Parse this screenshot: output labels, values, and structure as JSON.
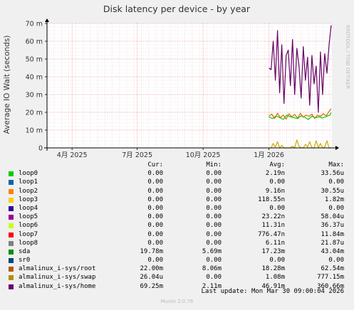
{
  "chart_data": {
    "type": "line",
    "title": "Disk latency per device - by year",
    "ylabel": "Average IO Wait (seconds)",
    "side_label": "RRDTOOL / TOBI OETIKER",
    "ylim": [
      0,
      0.07
    ],
    "y_ticks": [
      {
        "value": 0,
        "label": "0"
      },
      {
        "value": 0.01,
        "label": "10 m"
      },
      {
        "value": 0.02,
        "label": "20 m"
      },
      {
        "value": 0.03,
        "label": "30 m"
      },
      {
        "value": 0.04,
        "label": "40 m"
      },
      {
        "value": 0.05,
        "label": "50 m"
      },
      {
        "value": 0.06,
        "label": "60 m"
      },
      {
        "value": 0.07,
        "label": "70 m"
      }
    ],
    "xlim": [
      "2025-02-25",
      "2026-03-30"
    ],
    "x_ticks": [
      {
        "date": "2025-04-01",
        "label": "4月 2025"
      },
      {
        "date": "2025-07-01",
        "label": "7月 2025"
      },
      {
        "date": "2025-10-01",
        "label": "10月 2025"
      },
      {
        "date": "2026-01-01",
        "label": "1月 2026"
      }
    ],
    "series": [
      {
        "name": "almalinux_i-sys/home",
        "color": "#660066",
        "x": [
          "2026-01-01",
          "2026-01-04",
          "2026-01-07",
          "2026-01-10",
          "2026-01-13",
          "2026-01-16",
          "2026-01-19",
          "2026-01-22",
          "2026-01-25",
          "2026-01-28",
          "2026-01-31",
          "2026-02-03",
          "2026-02-06",
          "2026-02-09",
          "2026-02-12",
          "2026-02-15",
          "2026-02-18",
          "2026-02-21",
          "2026-02-24",
          "2026-02-27",
          "2026-03-02",
          "2026-03-05",
          "2026-03-08",
          "2026-03-11",
          "2026-03-14",
          "2026-03-17",
          "2026-03-20",
          "2026-03-23",
          "2026-03-26",
          "2026-03-29"
        ],
        "values": [
          0.045,
          0.044,
          0.06,
          0.038,
          0.066,
          0.031,
          0.058,
          0.025,
          0.052,
          0.055,
          0.035,
          0.061,
          0.03,
          0.056,
          0.046,
          0.028,
          0.057,
          0.038,
          0.051,
          0.024,
          0.052,
          0.036,
          0.046,
          0.02,
          0.054,
          0.03,
          0.053,
          0.042,
          0.058,
          0.069
        ]
      },
      {
        "name": "sda",
        "color": "#00cc00",
        "x": [
          "2026-01-01",
          "2026-01-06",
          "2026-01-11",
          "2026-01-16",
          "2026-01-21",
          "2026-01-26",
          "2026-01-31",
          "2026-02-05",
          "2026-02-10",
          "2026-02-15",
          "2026-02-20",
          "2026-02-25",
          "2026-03-02",
          "2026-03-07",
          "2026-03-12",
          "2026-03-17",
          "2026-03-22",
          "2026-03-27",
          "2026-03-29"
        ],
        "values": [
          0.0175,
          0.0165,
          0.018,
          0.017,
          0.016,
          0.0185,
          0.0175,
          0.017,
          0.0165,
          0.018,
          0.0172,
          0.016,
          0.0178,
          0.017,
          0.0175,
          0.0168,
          0.0176,
          0.0185,
          0.0198
        ]
      },
      {
        "name": "almalinux_i-sys/root",
        "color": "#cc7000",
        "x": [
          "2026-01-01",
          "2026-01-05",
          "2026-01-09",
          "2026-01-13",
          "2026-01-17",
          "2026-01-21",
          "2026-01-25",
          "2026-01-29",
          "2026-02-02",
          "2026-02-06",
          "2026-02-10",
          "2026-02-14",
          "2026-02-18",
          "2026-02-22",
          "2026-02-26",
          "2026-03-02",
          "2026-03-06",
          "2026-03-10",
          "2026-03-14",
          "2026-03-18",
          "2026-03-22",
          "2026-03-26",
          "2026-03-29"
        ],
        "values": [
          0.018,
          0.019,
          0.0165,
          0.0195,
          0.017,
          0.0185,
          0.0162,
          0.0192,
          0.0175,
          0.0188,
          0.0168,
          0.0195,
          0.0172,
          0.0185,
          0.0178,
          0.019,
          0.0165,
          0.0185,
          0.0178,
          0.0192,
          0.018,
          0.0205,
          0.022
        ]
      },
      {
        "name": "almalinux_i-sys/swap",
        "color": "#ccaa00",
        "x": [
          "2026-01-01",
          "2026-01-04",
          "2026-01-07",
          "2026-01-10",
          "2026-01-13",
          "2026-01-16",
          "2026-01-19",
          "2026-01-22",
          "2026-01-25",
          "2026-01-28",
          "2026-01-31",
          "2026-02-03",
          "2026-02-06",
          "2026-02-09",
          "2026-02-12",
          "2026-02-15",
          "2026-02-18",
          "2026-02-21",
          "2026-02-24",
          "2026-02-27",
          "2026-03-02",
          "2026-03-05",
          "2026-03-08",
          "2026-03-11",
          "2026-03-14",
          "2026-03-17",
          "2026-03-20",
          "2026-03-23",
          "2026-03-26",
          "2026-03-29"
        ],
        "values": [
          0.0,
          0.0,
          0.0025,
          0.0005,
          0.0035,
          0.0,
          0.0015,
          0.0,
          0.0,
          0.0,
          0.0,
          0.001,
          0.0,
          0.0045,
          0.001,
          0.0,
          0.0,
          0.002,
          0.0005,
          0.0035,
          0.0,
          0.0,
          0.004,
          0.0,
          0.0025,
          0.0,
          0.0005,
          0.004,
          0.0,
          0.0
        ]
      }
    ]
  },
  "legend": {
    "headers": [
      "Cur:",
      "Min:",
      "Avg:",
      "Max:"
    ],
    "rows": [
      {
        "name": "loop0",
        "color": "#00cc00",
        "cur": "0.00",
        "min": "0.00",
        "avg": "2.19n",
        "max": "33.56u"
      },
      {
        "name": "loop1",
        "color": "#0066b3",
        "cur": "0.00",
        "min": "0.00",
        "avg": "0.00",
        "max": "0.00"
      },
      {
        "name": "loop2",
        "color": "#ff8000",
        "cur": "0.00",
        "min": "0.00",
        "avg": "9.16n",
        "max": "30.55u"
      },
      {
        "name": "loop3",
        "color": "#ffcc00",
        "cur": "0.00",
        "min": "0.00",
        "avg": "118.55n",
        "max": "1.82m"
      },
      {
        "name": "loop4",
        "color": "#330099",
        "cur": "0.00",
        "min": "0.00",
        "avg": "0.00",
        "max": "0.00"
      },
      {
        "name": "loop5",
        "color": "#990099",
        "cur": "0.00",
        "min": "0.00",
        "avg": "23.22n",
        "max": "58.04u"
      },
      {
        "name": "loop6",
        "color": "#ccff00",
        "cur": "0.00",
        "min": "0.00",
        "avg": "11.31n",
        "max": "36.37u"
      },
      {
        "name": "loop7",
        "color": "#ff0000",
        "cur": "0.00",
        "min": "0.00",
        "avg": "776.47n",
        "max": "11.84m"
      },
      {
        "name": "loop8",
        "color": "#808080",
        "cur": "0.00",
        "min": "0.00",
        "avg": "6.11n",
        "max": "21.87u"
      },
      {
        "name": "sda",
        "color": "#008f00",
        "cur": "19.78m",
        "min": "5.69m",
        "avg": "17.23m",
        "max": "43.04m"
      },
      {
        "name": "sr0",
        "color": "#00487d",
        "cur": "0.00",
        "min": "0.00",
        "avg": "0.00",
        "max": "0.00"
      },
      {
        "name": "almalinux_i-sys/root",
        "color": "#b35a00",
        "cur": "22.00m",
        "min": "8.06m",
        "avg": "18.28m",
        "max": "62.54m"
      },
      {
        "name": "almalinux_i-sys/swap",
        "color": "#b38f00",
        "cur": "26.04u",
        "min": "0.00",
        "avg": "1.08m",
        "max": "777.15m"
      },
      {
        "name": "almalinux_i-sys/home",
        "color": "#6b006b",
        "cur": "69.25m",
        "min": "2.11m",
        "avg": "46.91m",
        "max": "360.66m"
      }
    ]
  },
  "footer": {
    "last_update": "Last update: Mon Mar 30 09:00:04 2026",
    "munin_version": "Munin 2.0.76"
  }
}
